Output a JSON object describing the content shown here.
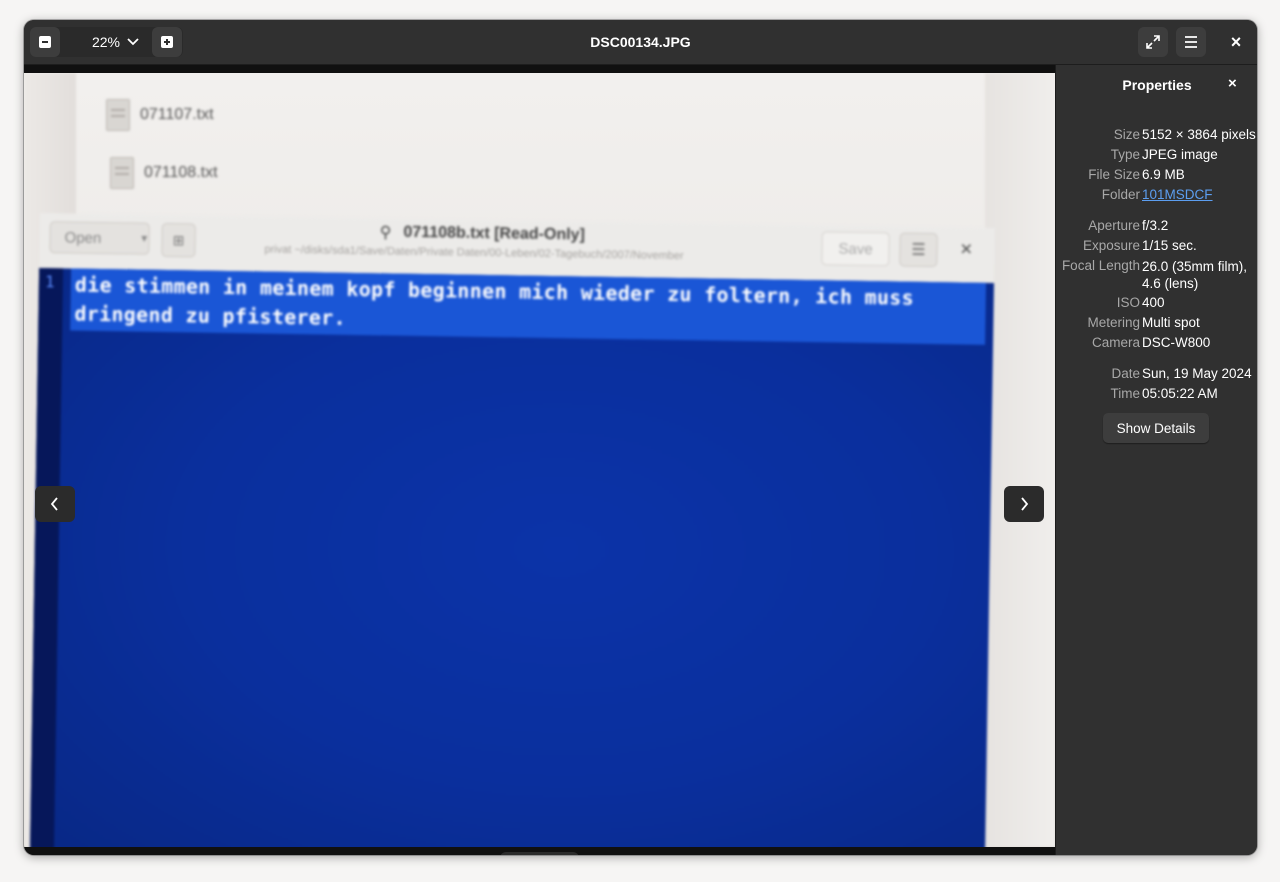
{
  "window": {
    "title": "DSC00134.JPG"
  },
  "toolbar": {
    "zoom_level": "22%",
    "zoom_out_icon": "minus-icon",
    "zoom_in_icon": "plus-icon",
    "close_glyph": "×"
  },
  "photo": {
    "files": [
      "071107.txt",
      "071108.txt"
    ],
    "editor": {
      "open_label": "Open",
      "title": "071108b.txt [Read-Only]",
      "path": "privat ~/disks/sda1/Save/Daten/Private Daten/00-Leben/02-Tagebuch/2007/November",
      "save_label": "Save",
      "line_number": "1",
      "lines": [
        "die stimmen in meinem kopf beginnen mich wieder zu foltern, ich muss",
        "dringend zu pfisterer."
      ]
    }
  },
  "properties": {
    "title": "Properties",
    "rows": [
      {
        "label": "Size",
        "value": "5152 × 3864 pixels"
      },
      {
        "label": "Type",
        "value": "JPEG image"
      },
      {
        "label": "File Size",
        "value": "6.9 MB"
      },
      {
        "label": "Folder",
        "value": "101MSDCF"
      },
      {
        "label": "Aperture",
        "value": "f/3.2"
      },
      {
        "label": "Exposure",
        "value": "1/15 sec."
      },
      {
        "label": "Focal Length",
        "value": "26.0 (35mm film), 4.6 (lens)"
      },
      {
        "label": "ISO",
        "value": "400"
      },
      {
        "label": "Metering",
        "value": "Multi spot"
      },
      {
        "label": "Camera",
        "value": "DSC-W800"
      },
      {
        "label": "Date",
        "value": "Sun, 19 May 2024"
      },
      {
        "label": "Time",
        "value": "05:05:22 AM"
      }
    ],
    "show_details_label": "Show Details"
  },
  "colors": {
    "header_bg": "#303030",
    "panel_bg": "#303030",
    "link": "#5c9ef0",
    "editor_blue": "#0a2f9d",
    "selection_blue": "#1a56d6"
  }
}
